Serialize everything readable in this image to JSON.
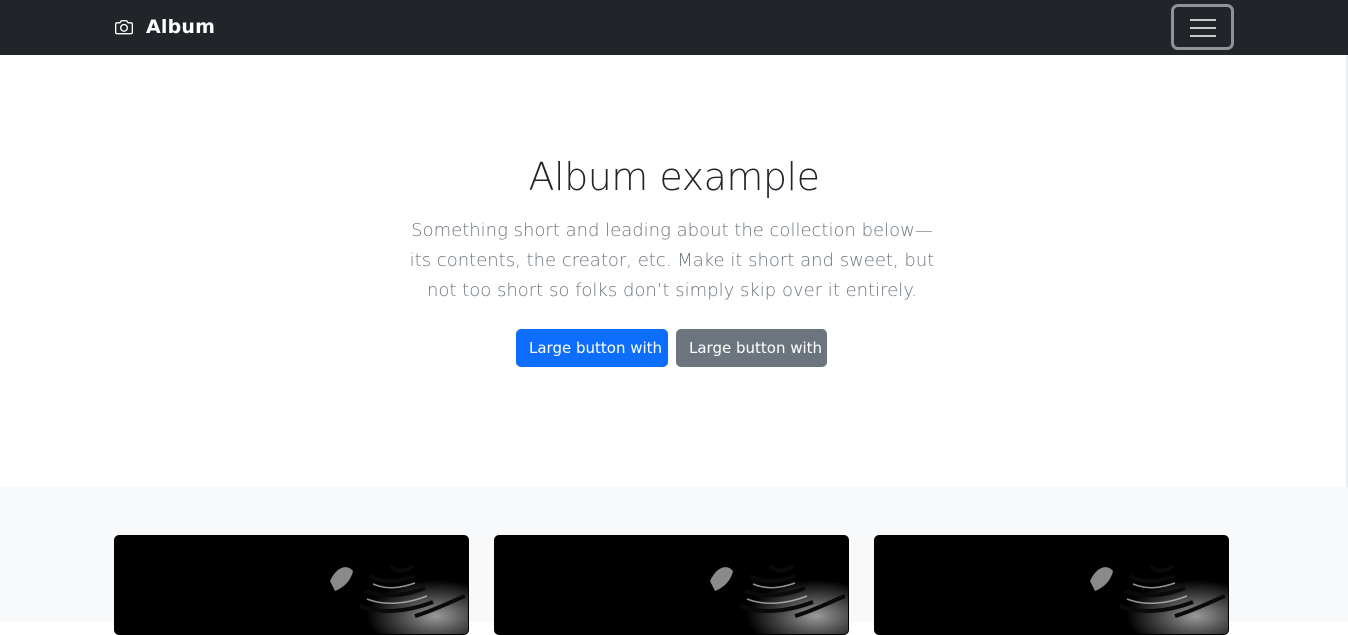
{
  "navbar": {
    "brand": "Album",
    "brand_icon": "camera-icon",
    "toggler_icon": "hamburger-menu-icon",
    "background": "#212529"
  },
  "hero": {
    "title": "Album example",
    "lead": "Something short and leading about the collection below—its contents, the creator, etc. Make it short and sweet, but not too short so folks don’t simply skip over it entirely.",
    "primary_button": "Large button with",
    "secondary_button": "Large button with"
  },
  "colors": {
    "primary": "#0d6efd",
    "secondary": "#6c757d",
    "album_background": "#f8f9fa"
  },
  "album": {
    "cards": [
      {
        "image": "tiger-photo"
      },
      {
        "image": "tiger-photo"
      },
      {
        "image": "tiger-photo"
      }
    ]
  }
}
